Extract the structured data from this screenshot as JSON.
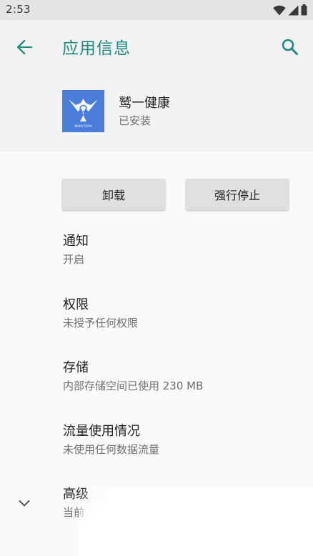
{
  "status_bar": {
    "time": "2:53",
    "icons": [
      "wifi-icon",
      "signal-icon",
      "battery-icon"
    ]
  },
  "app_bar": {
    "title": "应用信息",
    "back_icon": "arrow-back-icon",
    "search_icon": "search-icon",
    "accent_color": "#1e8a80"
  },
  "app": {
    "name": "鹫一健康",
    "status": "已安装",
    "icon_brand_text": "IKUNYTOOA",
    "icon_color": "#4a7cdb"
  },
  "buttons": {
    "uninstall": "卸载",
    "force_stop": "强行停止"
  },
  "prefs": [
    {
      "title": "通知",
      "summary": "开启"
    },
    {
      "title": "权限",
      "summary": "未授予任何权限"
    },
    {
      "title": "存储",
      "summary": "内部存储空间已使用 230 MB"
    },
    {
      "title": "流量使用情况",
      "summary": "未使用任何数据流量"
    },
    {
      "title": "高级",
      "summary": "当前"
    }
  ],
  "advanced_expand_icon": "chevron-down-icon"
}
